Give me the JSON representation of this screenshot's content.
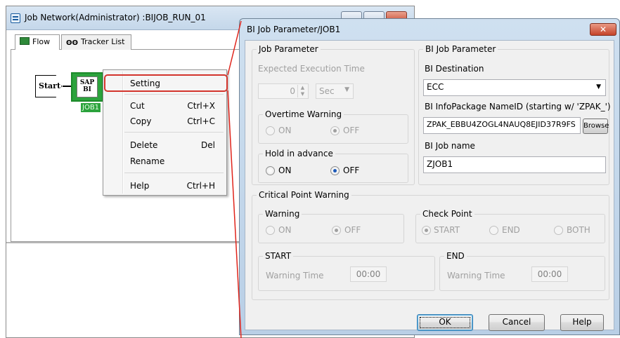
{
  "job_network_window": {
    "title": "Job Network(Administrator) :BIJOB_RUN_01",
    "tabs": [
      {
        "label": "Flow"
      },
      {
        "label": "Tracker List"
      }
    ],
    "tracker_icon_glyph": "ʘʘ",
    "flow": {
      "start_label": "Start",
      "sap_icon_line1": "SAP",
      "sap_icon_line2": "BI",
      "job_label": "JOB1"
    }
  },
  "context_menu": {
    "items": [
      {
        "label": "Setting",
        "shortcut": ""
      },
      {
        "label": "Cut",
        "shortcut": "Ctrl+X"
      },
      {
        "label": "Copy",
        "shortcut": "Ctrl+C"
      },
      {
        "label": "Delete",
        "shortcut": "Del"
      },
      {
        "label": "Rename",
        "shortcut": ""
      },
      {
        "label": "Help",
        "shortcut": "Ctrl+H"
      }
    ],
    "highlight_color": "#d3342c"
  },
  "dialog": {
    "title": "BI Job Parameter/JOB1",
    "close_glyph": "✕",
    "job_parameter": {
      "group_title": "Job Parameter",
      "expected_execution_time_label": "Expected Execution Time",
      "expected_execution_time_value": "0",
      "unit_value": "Sec",
      "overtime_warning": {
        "title": "Overtime Warning",
        "on_label": "ON",
        "off_label": "OFF",
        "selected": "OFF"
      },
      "hold_in_advance": {
        "title": "Hold in advance",
        "on_label": "ON",
        "off_label": "OFF",
        "selected": "OFF"
      }
    },
    "bi_job_parameter": {
      "group_title": "BI Job Parameter",
      "destination_label": "BI Destination",
      "destination_value": "ECC",
      "infopackage_label": "BI InfoPackage NameID (starting w/ 'ZPAK_')",
      "infopackage_value": "ZPAK_EBBU4ZOGL4NAUQ8EJID37R9FS",
      "browse_label": "Browse",
      "job_name_label": "BI Job name",
      "job_name_value": "ZJOB1"
    },
    "critical_point_warning": {
      "group_title": "Critical Point Warning",
      "warning": {
        "title": "Warning",
        "on_label": "ON",
        "off_label": "OFF",
        "selected": "OFF"
      },
      "check_point": {
        "title": "Check Point",
        "start_label": "START",
        "end_label": "END",
        "both_label": "BOTH",
        "selected": "START"
      },
      "start_group": {
        "title": "START",
        "warning_time_label": "Warning Time",
        "warning_time_value": "00:00"
      },
      "end_group": {
        "title": "END",
        "warning_time_label": "Warning Time",
        "warning_time_value": "00:00"
      }
    },
    "buttons": {
      "ok": "OK",
      "cancel": "Cancel",
      "help": "Help"
    }
  }
}
